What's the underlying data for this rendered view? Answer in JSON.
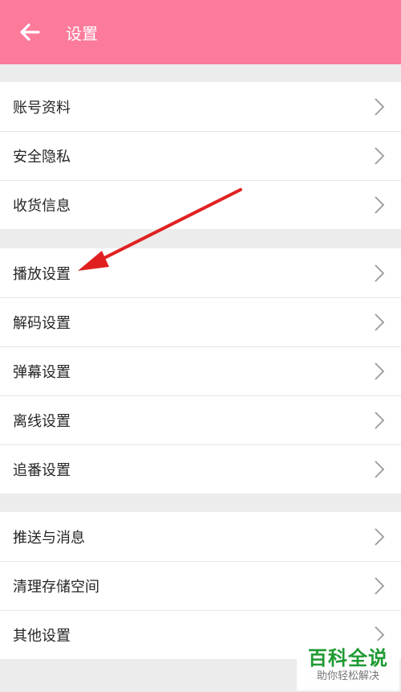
{
  "header": {
    "title": "设置",
    "back_icon": "arrow-left-icon",
    "color": "#fc7a9a"
  },
  "groups": [
    {
      "items": [
        "账号资料",
        "安全隐私",
        "收货信息"
      ]
    },
    {
      "items": [
        "播放设置",
        "解码设置",
        "弹幕设置",
        "离线设置",
        "追番设置"
      ]
    },
    {
      "items": [
        "推送与消息",
        "清理存储空间",
        "其他设置"
      ]
    }
  ],
  "annotation": {
    "color": "#e02020",
    "icon": "red-arrow-icon"
  },
  "watermark": {
    "title": "百科全说",
    "subtitle": "助你轻松解决"
  }
}
